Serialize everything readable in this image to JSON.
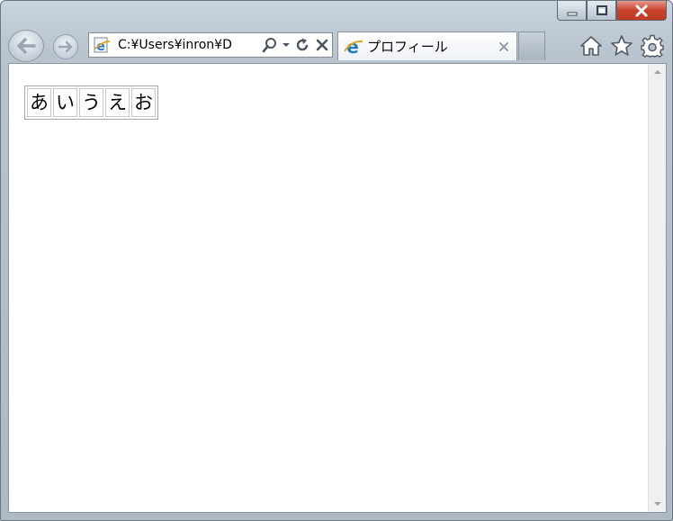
{
  "window": {
    "caption_buttons": [
      "minimize",
      "maximize",
      "close"
    ]
  },
  "toolbar": {
    "address_text": "C:¥Users¥inron¥D",
    "tab_title": "プロフィール"
  },
  "icons": {
    "back": "back-arrow-icon",
    "forward": "forward-arrow-icon",
    "favicon": "ie-logo-icon",
    "search": "search-icon",
    "dropdown": "chevron-down-icon",
    "refresh": "refresh-icon",
    "stop": "close-icon",
    "home": "home-icon",
    "favorites": "star-icon",
    "tools": "gear-icon"
  },
  "page": {
    "cells": [
      "あ",
      "い",
      "う",
      "え",
      "お"
    ]
  },
  "colors": {
    "close_button": "#c8412c",
    "ie_blue": "#1f77c9",
    "ie_gold": "#e8a51a"
  }
}
